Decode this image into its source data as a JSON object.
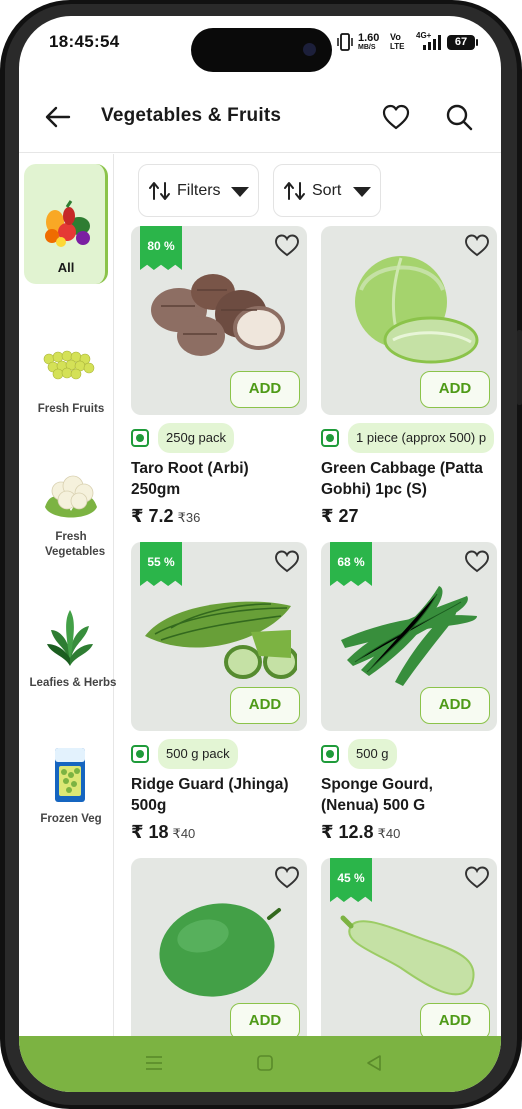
{
  "status_bar": {
    "time": "18:45:54",
    "net_speed": "1.60",
    "net_unit": "MB/S",
    "volte_top": "Vo",
    "volte_bottom": "LTE",
    "signal_label": "4G+",
    "battery": "67"
  },
  "header": {
    "title": "Vegetables & Fruits",
    "back_icon": "back-arrow-icon",
    "wishlist_icon": "heart-icon",
    "search_icon": "search-icon"
  },
  "sidebar": {
    "items": [
      {
        "label": "All",
        "active": true,
        "icon": "mixed-produce"
      },
      {
        "label": "Fresh Fruits",
        "active": false,
        "icon": "grapes"
      },
      {
        "label": "Fresh Vegetables",
        "active": false,
        "icon": "cauliflower"
      },
      {
        "label": "Leafies & Herbs",
        "active": false,
        "icon": "leafy-greens"
      },
      {
        "label": "Frozen Veg",
        "active": false,
        "icon": "frozen-peas-pack"
      }
    ]
  },
  "toolbar": {
    "filters_label": "Filters",
    "sort_label": "Sort"
  },
  "products": [
    {
      "discount": "80 %",
      "pack": "250g pack",
      "name_line1": "Taro Root (Arbi)",
      "name_line2": "250gm",
      "price": "₹ 7.2",
      "mrp": "₹36",
      "add_label": "ADD"
    },
    {
      "discount": "",
      "pack": "1 piece (approx 500) p",
      "name_line1": "Green Cabbage (Patta",
      "name_line2": "Gobhi) 1pc (S)",
      "price": "₹ 27",
      "mrp": "",
      "add_label": "ADD"
    },
    {
      "discount": "55 %",
      "pack": "500 g pack",
      "name_line1": "Ridge Guard (Jhinga)",
      "name_line2": "500g",
      "price": "₹ 18",
      "mrp": "₹40",
      "add_label": "ADD"
    },
    {
      "discount": "68 %",
      "pack": "500 g",
      "name_line1": "Sponge Gourd,",
      "name_line2": "(Nenua) 500 G",
      "price": "₹ 12.8",
      "mrp": "₹40",
      "add_label": "ADD"
    },
    {
      "discount": "",
      "pack": "",
      "name_line1": "",
      "name_line2": "",
      "price": "",
      "mrp": "",
      "add_label": "ADD"
    },
    {
      "discount": "45 %",
      "pack": "",
      "name_line1": "",
      "name_line2": "",
      "price": "",
      "mrp": "",
      "add_label": "ADD"
    }
  ],
  "colors": {
    "accent_green": "#8bc34a",
    "discount_badge": "#2bb54a",
    "nav_bar": "#7cb342"
  }
}
